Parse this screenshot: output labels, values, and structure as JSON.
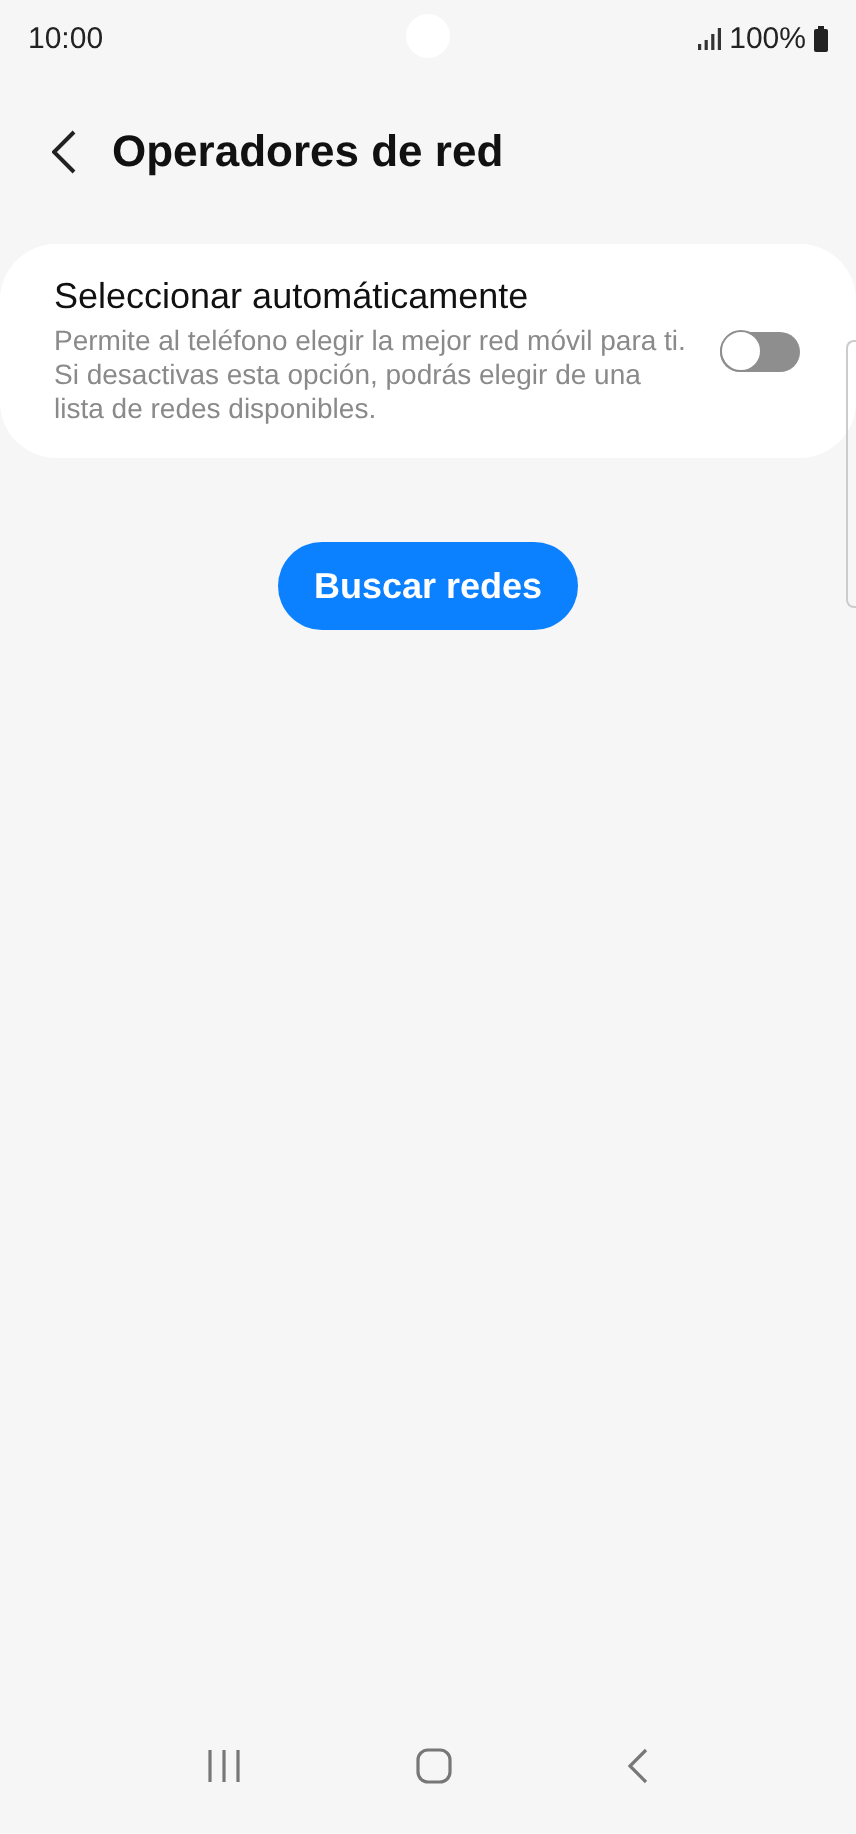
{
  "status_bar": {
    "time": "10:00",
    "battery": "100%"
  },
  "header": {
    "title": "Operadores de red"
  },
  "setting": {
    "title": "Seleccionar automáticamente",
    "description": "Permite al teléfono elegir la mejor red móvil para ti. Si desactivas esta opción, podrás elegir de una lista de redes disponibles.",
    "on": false
  },
  "button": {
    "label": "Buscar redes"
  }
}
